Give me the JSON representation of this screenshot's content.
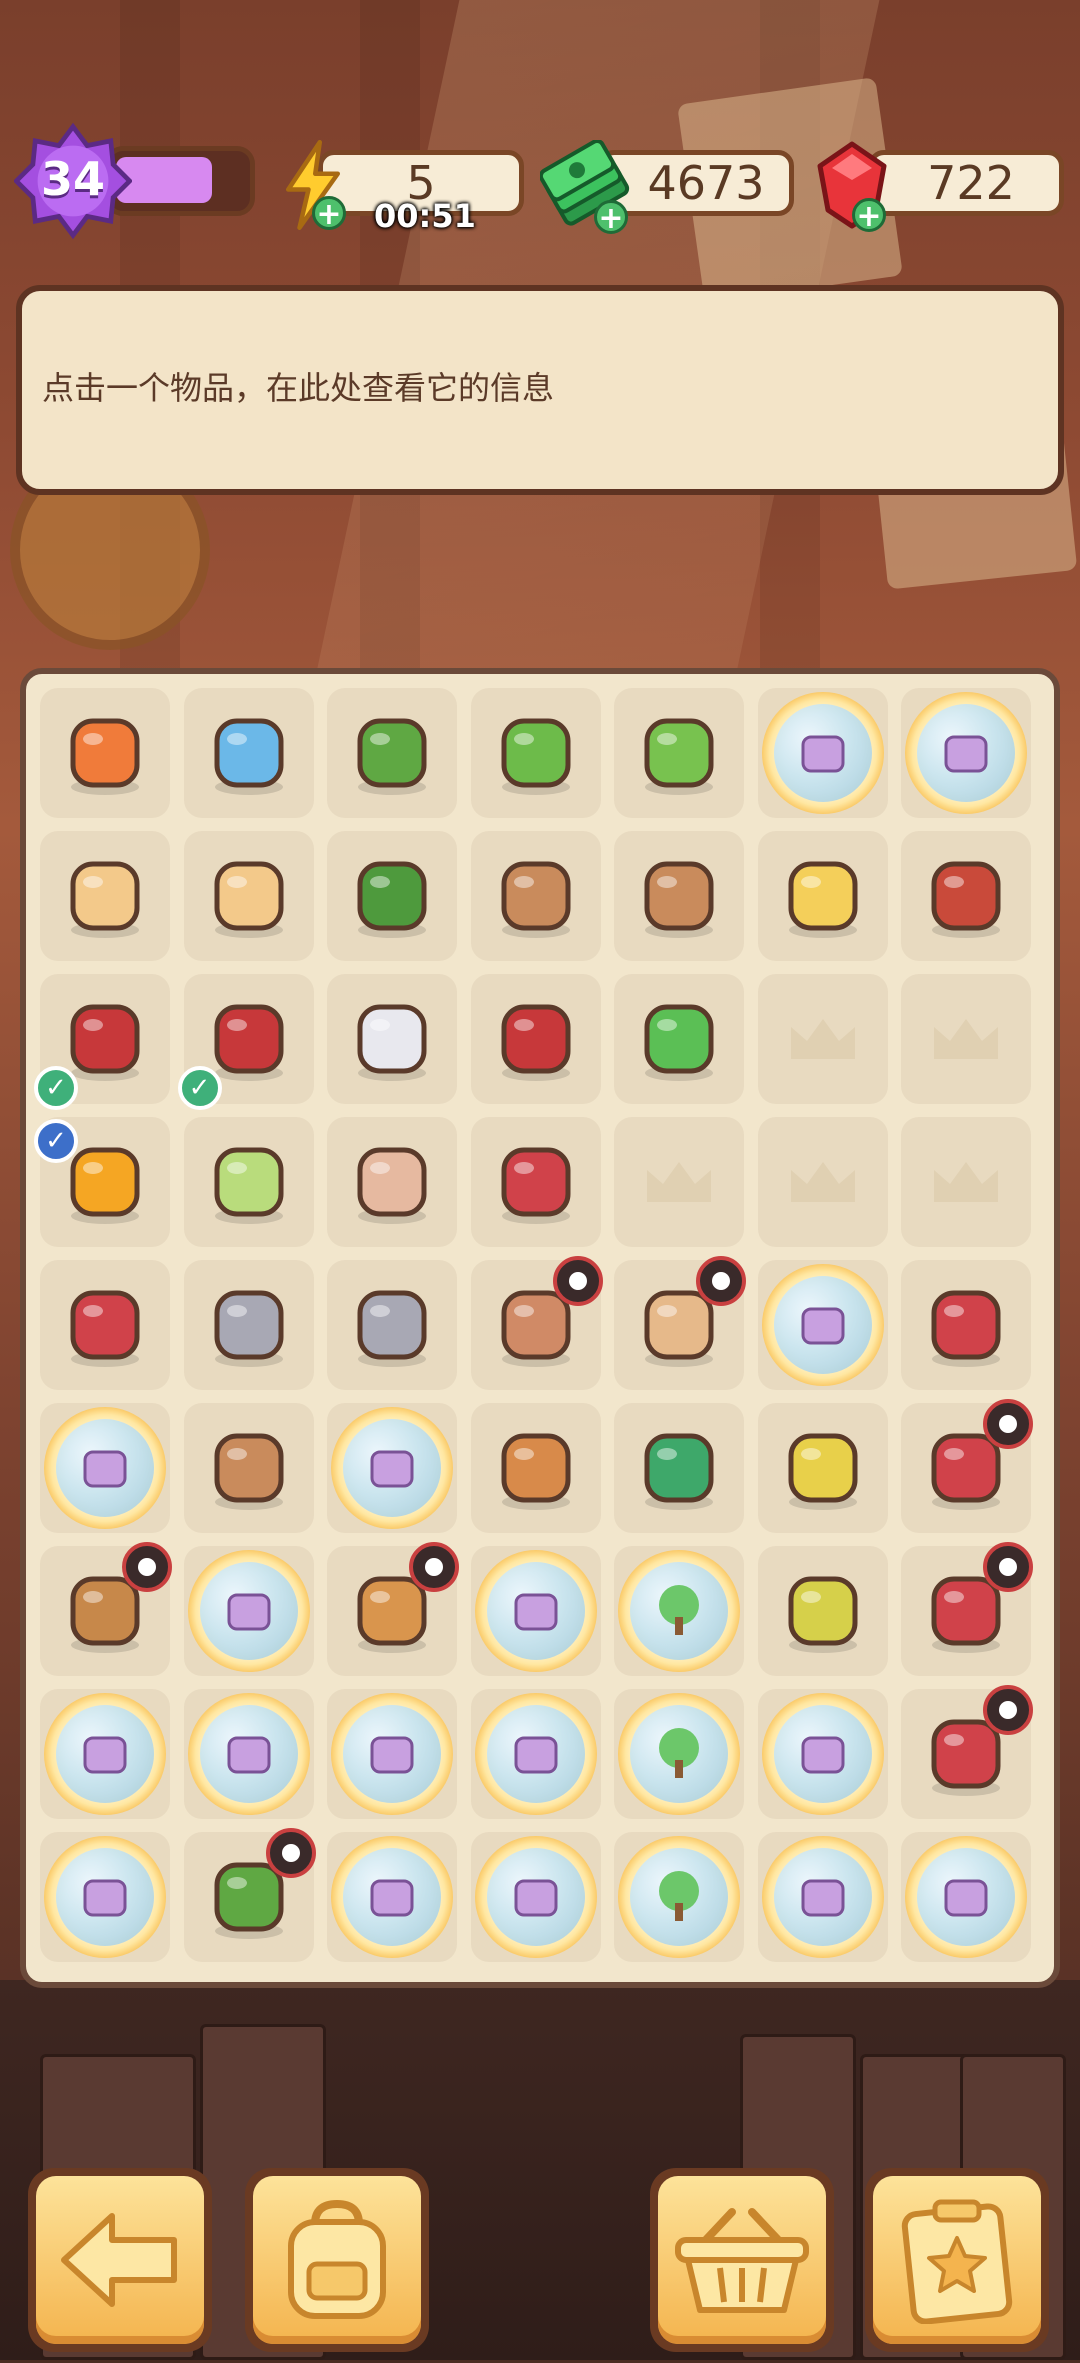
{
  "hud": {
    "level": "34",
    "level_progress": 0.75,
    "energy": "5",
    "energy_timer": "00:51",
    "cash": "4673",
    "gems": "722"
  },
  "info_panel": {
    "text": "点击一个物品，在此处查看它的信息"
  },
  "board": {
    "rows": [
      [
        "event-chip",
        "hourglass",
        "potted-plant",
        "potted-sprout-large",
        "potted-sprout",
        "mystery-crate-glow",
        "lightbulb-crate-glow"
      ],
      [
        "biscuit-pair",
        "biscuit",
        "berry-bush",
        "clay-pot-broken",
        "clay-shard",
        "spotted-egg",
        "hand-trowel"
      ],
      [
        "red-gloves-checked",
        "red-gloves-checked",
        "work-gloves",
        "hand-fork",
        "green-dino",
        "empty-slot",
        "empty-slot"
      ],
      [
        "juice-box-checked",
        "shanghai-soap",
        "glass-vase",
        "pruning-shears",
        "empty-slot",
        "empty-slot",
        "empty-slot"
      ],
      [
        "hand-saw",
        "pickaxe",
        "rake",
        "round-vase-locked",
        "striped-vase-locked",
        "bubble-item-glow",
        "red-tray"
      ],
      [
        "perfume-glow",
        "clay-planter",
        "magnifier-crate-glow",
        "leather-case",
        "bonsai",
        "yellow-bucket",
        "red-toolbox-locked"
      ],
      [
        "wood-crate-locked",
        "glow-bubble",
        "open-crate-locked",
        "glow-bubble",
        "glow-tree-bubble",
        "watering-can",
        "red-toolcase-locked"
      ],
      [
        "glow-bubble",
        "glow-bubble",
        "glow-bubble",
        "glow-bubble",
        "glow-tree-bubble",
        "glow-bubble",
        "red-toolbox-handle-locked"
      ],
      [
        "glow-bubble",
        "potted-basket-locked",
        "glow-bubble",
        "glow-bubble",
        "glow-tree-bubble",
        "glow-bubble",
        "glow-bubble"
      ]
    ]
  },
  "buttons": {
    "back": "back-arrow-icon",
    "backpack": "backpack-icon",
    "basket": "basket-icon",
    "tasks": "clipboard-star-icon"
  },
  "colors": {
    "panel_bg": "#f3e4c8",
    "board_bg": "#f2e6cc",
    "level_purple": "#d789f0",
    "button_gold": "#f4b44e"
  }
}
